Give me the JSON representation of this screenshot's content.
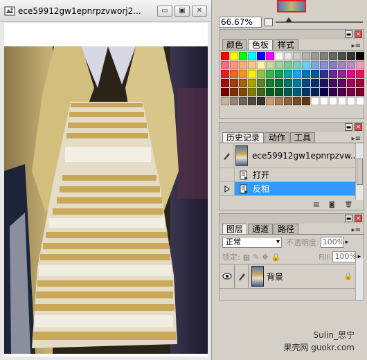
{
  "document": {
    "title": "ece59912gw1epnrpzvworj2...",
    "minimize_label": "▭",
    "maximize_label": "▣",
    "close_label": "✕"
  },
  "navigator": {
    "zoom": "66.67%"
  },
  "swatches_panel": {
    "tabs": [
      "颜色",
      "色板",
      "样式"
    ],
    "active_tab": 1,
    "colors": [
      "#ff0000",
      "#ffff00",
      "#00ff00",
      "#00ffff",
      "#0000ff",
      "#ff00ff",
      "#ffffff",
      "#e6e6e6",
      "#cccccc",
      "#b3b3b3",
      "#999999",
      "#808080",
      "#666666",
      "#4d4d4d",
      "#333333",
      "#000000",
      "#f26d7d",
      "#f7977a",
      "#fbad82",
      "#fdc68c",
      "#fff799",
      "#c4df9b",
      "#a3d39c",
      "#82ca9c",
      "#7accc8",
      "#6dcff6",
      "#7da7d8",
      "#8393ca",
      "#8781bd",
      "#a187be",
      "#bd8cbf",
      "#f49ac1",
      "#ed1c24",
      "#f26522",
      "#f7941d",
      "#fff200",
      "#8dc63f",
      "#39b54a",
      "#00a651",
      "#00a99d",
      "#00aeef",
      "#0072bc",
      "#0054a6",
      "#2e3192",
      "#662d91",
      "#92278f",
      "#ec008c",
      "#ed145b",
      "#9e0b0f",
      "#a0410d",
      "#a3620a",
      "#aba000",
      "#598527",
      "#197b30",
      "#007236",
      "#00746b",
      "#0076a3",
      "#004a80",
      "#003471",
      "#1b1464",
      "#440e62",
      "#630460",
      "#9e005d",
      "#9e0039",
      "#790000",
      "#7b2e00",
      "#7d4900",
      "#827b00",
      "#406618",
      "#005e20",
      "#005826",
      "#005952",
      "#005b7f",
      "#003663",
      "#002157",
      "#0d004c",
      "#32004b",
      "#4b0049",
      "#7b0046",
      "#7a0026",
      "#c7b299",
      "#998675",
      "#736357",
      "#534741",
      "#37302d",
      "#c69c6d",
      "#a67c52",
      "#8c6239",
      "#754c24",
      "#603913",
      "#ffffff",
      "#ffffff",
      "#ffffff",
      "#ffffff",
      "#ffffff",
      "#ffffff"
    ]
  },
  "history_panel": {
    "tabs": [
      "历史记录",
      "动作",
      "工具"
    ],
    "active_tab": 0,
    "snapshot_label": "ece59912gw1epnrpzvw...",
    "steps": [
      "打开",
      "反相"
    ],
    "selected_step": 1
  },
  "layers_panel": {
    "tabs": [
      "图层",
      "通道",
      "路径"
    ],
    "active_tab": 0,
    "blend_mode": "正常",
    "opacity_label": "不透明度:",
    "opacity_value": "100%",
    "lock_label": "锁定:",
    "fill_label": "Fill:",
    "fill_value": "100%",
    "layers": [
      {
        "name": "背景",
        "selected": true
      }
    ]
  },
  "watermark": {
    "line1": "Sulin_思宁",
    "line2": "果壳网 guokr.com"
  }
}
